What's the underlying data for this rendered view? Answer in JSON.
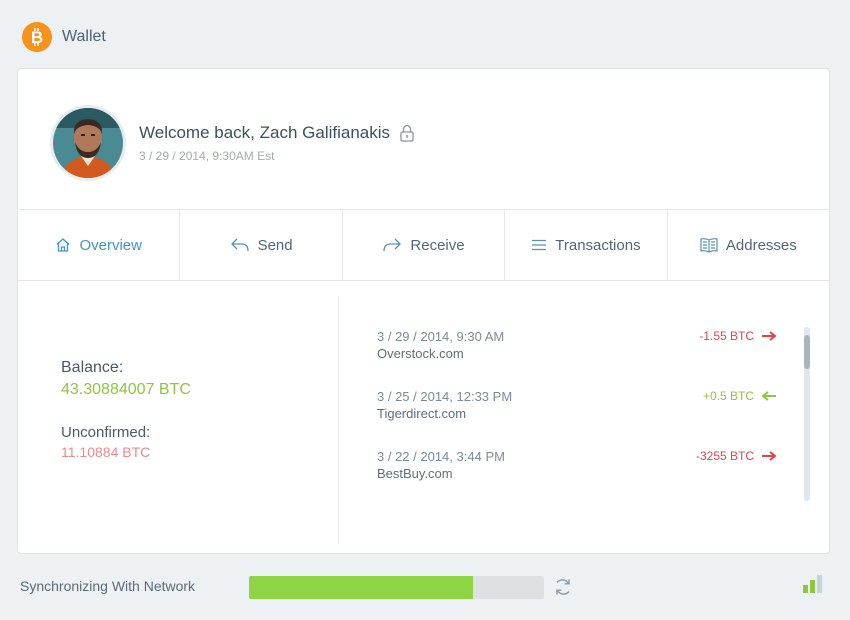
{
  "app": {
    "title": "Wallet",
    "logo_icon": "bitcoin-logo-icon"
  },
  "user": {
    "welcome": "Welcome back, Zach Galifianakis",
    "datetime": "3 / 29 / 2014,  9:30AM Est",
    "avatar": "user-avatar-photo",
    "lock_icon": "lock-icon"
  },
  "tabs": [
    {
      "label": "Overview",
      "icon": "home-icon",
      "active": true
    },
    {
      "label": "Send",
      "icon": "reply-arrow-icon",
      "active": false
    },
    {
      "label": "Receive",
      "icon": "forward-arrow-icon",
      "active": false
    },
    {
      "label": "Transactions",
      "icon": "list-icon",
      "active": false
    },
    {
      "label": "Addresses",
      "icon": "address-book-icon",
      "active": false
    }
  ],
  "balance": {
    "label": "Balance:",
    "value": "43.30884007 BTC",
    "unconfirmed_label": "Unconfirmed:",
    "unconfirmed_value": "11.10884 BTC"
  },
  "transactions": [
    {
      "date": "3 / 29 / 2014,  9:30",
      "ampm": "AM",
      "merchant": "Overstock.com",
      "amount": "-1.55 BTC",
      "direction": "out"
    },
    {
      "date": "3 / 25 / 2014,  12:33",
      "ampm": "PM",
      "merchant": "Tigerdirect.com",
      "amount": "+0.5 BTC",
      "direction": "in"
    },
    {
      "date": "3 / 22 / 2014,  3:44",
      "ampm": "PM",
      "merchant": "BestBuy.com",
      "amount": "-3255 BTC",
      "direction": "out"
    }
  ],
  "footer": {
    "sync_label": "Synchronizing With Network",
    "sync_progress": 0.76,
    "sync_icon": "refresh-icon",
    "signal_icon": "signal-bars-icon"
  },
  "colors": {
    "accent": "#3d97c7",
    "positive": "#8dc63f",
    "negative": "#e0444b",
    "unconfirmed": "#ec8a8a",
    "bitcoin": "#f7931a",
    "progress_fill": "#8ed445"
  }
}
